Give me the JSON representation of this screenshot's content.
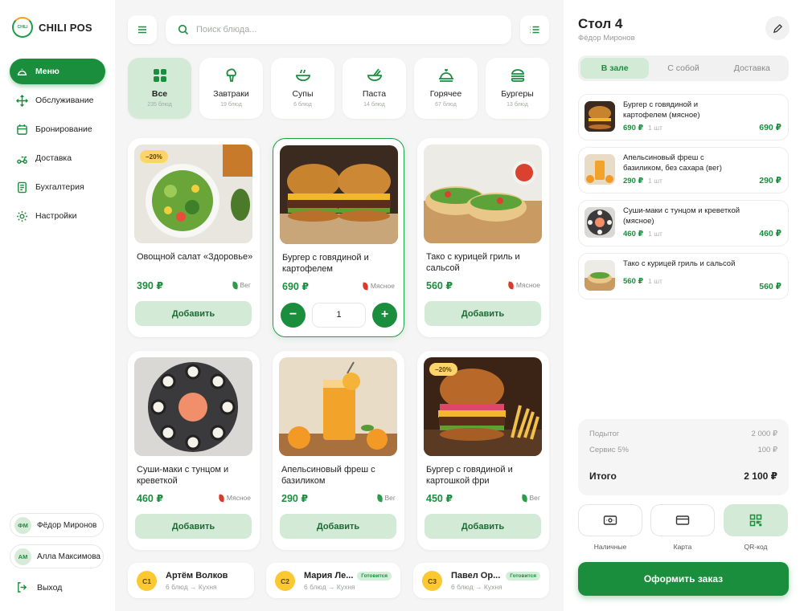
{
  "app": {
    "name": "CHILI POS",
    "logo_text": "CHILI"
  },
  "sidebar": {
    "nav": [
      {
        "label": "Меню",
        "icon": "menu-dish-icon",
        "active": true
      },
      {
        "label": "Обслуживание",
        "icon": "arrows-move-icon",
        "active": false
      },
      {
        "label": "Бронирование",
        "icon": "calendar-icon",
        "active": false
      },
      {
        "label": "Доставка",
        "icon": "scooter-icon",
        "active": false
      },
      {
        "label": "Бухгалтерия",
        "icon": "ledger-icon",
        "active": false
      },
      {
        "label": "Настройки",
        "icon": "gear-icon",
        "active": false
      }
    ],
    "staff": [
      {
        "initials": "ФМ",
        "name": "Фёдор Миронов"
      },
      {
        "initials": "АМ",
        "name": "Алла Максимова"
      }
    ],
    "logout_label": "Выход"
  },
  "search": {
    "placeholder": "Поиск блюда..."
  },
  "categories": [
    {
      "name": "Все",
      "count": "235 блюд",
      "icon": "grid-icon",
      "active": true
    },
    {
      "name": "Завтраки",
      "count": "19 блюд",
      "icon": "broccoli-icon",
      "active": false
    },
    {
      "name": "Супы",
      "count": "6 блюд",
      "icon": "soup-bowl-icon",
      "active": false
    },
    {
      "name": "Паста",
      "count": "14 блюд",
      "icon": "pasta-bowl-icon",
      "active": false
    },
    {
      "name": "Горячее",
      "count": "67 блюд",
      "icon": "cloche-icon",
      "active": false
    },
    {
      "name": "Бургеры",
      "count": "13 блюд",
      "icon": "burger-icon",
      "active": false
    }
  ],
  "products": [
    {
      "title": "Овощной салат «Здоровье»",
      "price": "390 ₽",
      "tag": "Вег",
      "tag_color": "#2e9b4a",
      "badge": "−20%",
      "image": "salad",
      "add_label": "Добавить"
    },
    {
      "title": "Бургер с говядиной и картофелем",
      "price": "690 ₽",
      "tag": "Мясное",
      "tag_color": "#d83a2c",
      "badge": "",
      "image": "burgers",
      "quantity": "1"
    },
    {
      "title": "Тако с курицей гриль и сальсой",
      "price": "560 ₽",
      "tag": "Мясное",
      "tag_color": "#d83a2c",
      "badge": "",
      "image": "tacos",
      "add_label": "Добавить"
    },
    {
      "title": "Суши-маки с тунцом и креветкой",
      "price": "460 ₽",
      "tag": "Мясное",
      "tag_color": "#d83a2c",
      "badge": "",
      "image": "sushi",
      "add_label": "Добавить"
    },
    {
      "title": "Апельсиновый фреш с базиликом",
      "price": "290 ₽",
      "tag": "Вег",
      "tag_color": "#2e9b4a",
      "badge": "",
      "image": "juice",
      "add_label": "Добавить"
    },
    {
      "title": "Бургер с говядиной и картошкой фри",
      "price": "450 ₽",
      "tag": "Вег",
      "tag_color": "#2e9b4a",
      "badge": "−20%",
      "image": "burger-fries",
      "add_label": "Добавить"
    }
  ],
  "kitchen_queue": [
    {
      "initials": "C1",
      "name": "Артём Волков",
      "sub": "6 блюд → Кухня",
      "status": ""
    },
    {
      "initials": "C2",
      "name": "Мария Ле...",
      "sub": "6 блюд → Кухня",
      "status": "Готовится"
    },
    {
      "initials": "C3",
      "name": "Павел Ор...",
      "sub": "6 блюд → Кухня",
      "status": "Готовится"
    }
  ],
  "order": {
    "title": "Стол 4",
    "waiter": "Фёдор Миронов",
    "tabs": [
      {
        "label": "В зале",
        "active": true
      },
      {
        "label": "С собой",
        "active": false
      },
      {
        "label": "Доставка",
        "active": false
      }
    ],
    "items": [
      {
        "name": "Бургер с говядиной и картофелем (мясное)",
        "price": "690 ₽",
        "qty": "1 шт",
        "total": "690 ₽",
        "image": "burgers"
      },
      {
        "name": "Апельсиновый фреш с базиликом, без сахара (вег)",
        "price": "290 ₽",
        "qty": "1 шт",
        "total": "290 ₽",
        "image": "juice"
      },
      {
        "name": "Суши-маки с тунцом и креветкой (мясное)",
        "price": "460 ₽",
        "qty": "1 шт",
        "total": "460 ₽",
        "image": "sushi"
      },
      {
        "name": "Тако с курицей гриль и сальсой",
        "price": "560 ₽",
        "qty": "1 шт",
        "total": "560 ₽",
        "image": "tacos"
      }
    ],
    "summary": {
      "subtotal_label": "Подытог",
      "subtotal": "2 000 ₽",
      "service_label": "Сервис 5%",
      "service": "100 ₽",
      "total_label": "Итого",
      "total": "2 100 ₽"
    },
    "payment": [
      {
        "label": "Наличные",
        "icon": "cash-icon",
        "active": false
      },
      {
        "label": "Карта",
        "icon": "card-icon",
        "active": false
      },
      {
        "label": "QR-код",
        "icon": "qr-code-icon",
        "active": true
      }
    ],
    "checkout_label": "Оформить заказ"
  },
  "colors": {
    "accent": "#1b8e3e",
    "accent_soft": "#d2ead6",
    "badge": "#fcd46a",
    "meat": "#d83a2c",
    "veg": "#2e9b4a"
  }
}
